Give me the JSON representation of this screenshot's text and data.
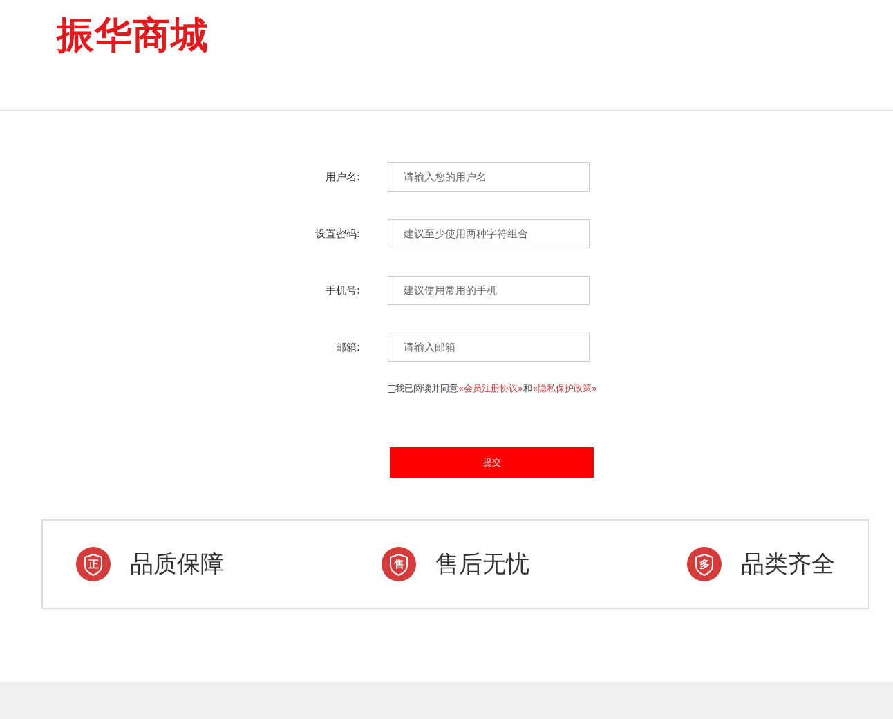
{
  "logo": "振华商城",
  "fields": [
    {
      "label": "用户名:",
      "placeholder": "请输入您的用户名"
    },
    {
      "label": "设置密码:",
      "placeholder": "建议至少使用两种字符组合"
    },
    {
      "label": "手机号:",
      "placeholder": "建议使用常用的手机"
    },
    {
      "label": "邮箱:",
      "placeholder": "请输入邮箱"
    }
  ],
  "agreement": {
    "checked": false,
    "text": "我已阅读并同意",
    "link_1": "«会员注册协议»",
    "conjunction": "和",
    "link_2": "«隐私保护政策»"
  },
  "submit": "提交",
  "features": [
    {
      "badge": "正",
      "label": "品质保障"
    },
    {
      "badge": "售",
      "label": "售后无忧"
    },
    {
      "badge": "多",
      "label": "品类齐全"
    }
  ]
}
